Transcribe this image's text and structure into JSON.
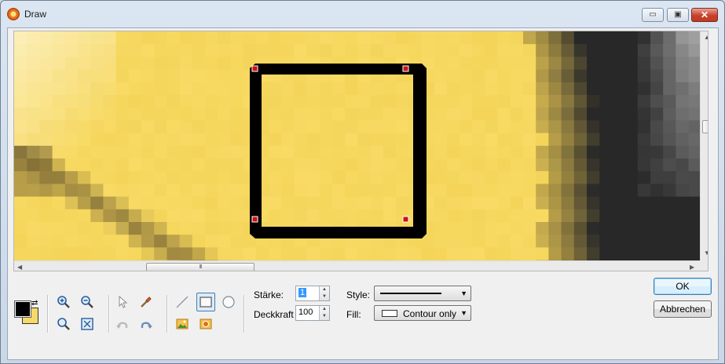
{
  "window": {
    "title": "Draw",
    "icon": "sun-app-icon"
  },
  "titlebar_buttons": {
    "minimize": "▭",
    "maximize": "▣",
    "close": "✕"
  },
  "canvas": {
    "image": "zoomed-pixel-image",
    "shape": {
      "type": "rectangle",
      "stroke_color": "#000000",
      "fill": "none",
      "selected": true,
      "handle_color": "#cc1111"
    }
  },
  "scrollbars": {
    "horizontal_grip": "III"
  },
  "colors": {
    "foreground": "#000000",
    "background": "#f7d96a",
    "accent": "#3c7fb1"
  },
  "tools": [
    {
      "name": "zoom-in-icon",
      "active": false
    },
    {
      "name": "zoom-out-icon",
      "active": false
    },
    {
      "name": "zoom-icon",
      "active": false
    },
    {
      "name": "fit-to-window-icon",
      "active": false
    },
    {
      "name": "pointer-icon",
      "active": false
    },
    {
      "name": "color-picker-icon",
      "active": false
    },
    {
      "name": "undo-icon",
      "active": false
    },
    {
      "name": "redo-icon",
      "active": false
    },
    {
      "name": "line-tool-icon",
      "active": false
    },
    {
      "name": "rectangle-tool-icon",
      "active": true
    },
    {
      "name": "ellipse-tool-icon",
      "active": false
    },
    {
      "name": "insert-image-icon",
      "active": false
    },
    {
      "name": "insert-image-frame-icon",
      "active": false
    }
  ],
  "properties": {
    "staerke_label": "Stärke:",
    "staerke_value": "1",
    "deckkraft_label": "Deckkraft",
    "deckkraft_value": "100",
    "style_label": "Style:",
    "style_value": "solid-line",
    "fill_label": "Fill:",
    "fill_value": "Contour only"
  },
  "buttons": {
    "ok": "OK",
    "cancel": "Abbrechen"
  }
}
